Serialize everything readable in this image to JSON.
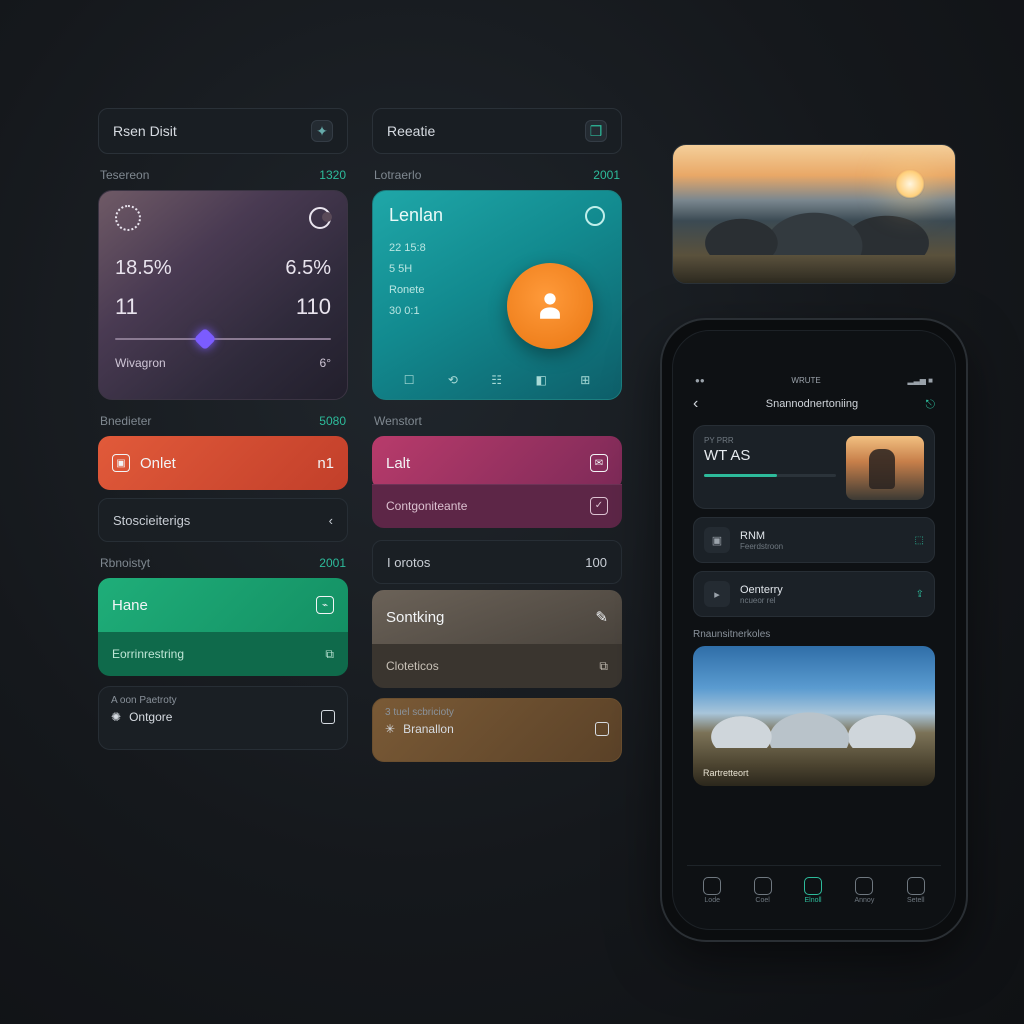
{
  "col1": {
    "header": "Rsen Disit",
    "section1": {
      "label": "Tesereon",
      "value": "1320"
    },
    "weather": {
      "val_left": "18.5%",
      "val_right": "6.5%",
      "num_left": "11",
      "num_right": "110",
      "footer_left": "Wivagron",
      "footer_right": "6°"
    },
    "section2": {
      "label": "Bnedieter",
      "value": "5080"
    },
    "card_red": "Onlet",
    "card_red_badge": "n1",
    "row1": "Stoscieiterigs",
    "section3": {
      "label": "Rbnoistyt",
      "value": "2001"
    },
    "card_green": "Hane",
    "card_green_sub": "Eorrinrestring",
    "mini_label": "A oon Paetroty",
    "mini_item": "Ontgore"
  },
  "col2": {
    "header": "Reeatie",
    "section1": {
      "label": "Lotraerlo",
      "value": "2001"
    },
    "teal": {
      "title": "Lenlan",
      "rows": [
        "22 15:8",
        "5 5H",
        "Ronete",
        "30 0:1"
      ],
      "icons": [
        "☐",
        "⟲",
        "☷",
        "◧",
        "⊞"
      ]
    },
    "section2": {
      "label": "Wenstort",
      "value": ""
    },
    "card_mag": "Lalt",
    "card_mag_sub": "Contgoniteante",
    "row1": "I orotos",
    "card_gry": "Sontking",
    "card_gry_sub": "Cloteticos",
    "mini_label": "3 tuel scbricioty",
    "mini_item": "Branallon"
  },
  "phone": {
    "status_left": "●●",
    "status_mid": "WRUTE",
    "status_right": "▂▃▅ ■",
    "nav_title": "Snannodnertoniing",
    "nav_acc": "⎋",
    "play": {
      "tag": "PY PRR",
      "title": "WT AS"
    },
    "list": [
      {
        "icon": "▣",
        "title": "RNM",
        "sub": "Feerdstroon",
        "badge": "⬚"
      },
      {
        "icon": "▸",
        "title": "Oenterry",
        "sub": "ncueor rel",
        "badge": "⇪"
      }
    ],
    "section": "Rnaunsitnerkoles",
    "caption": "Rartretteort",
    "tabs": [
      "Lode",
      "Coel",
      "Elnoll",
      "Annoy",
      "Setell"
    ]
  }
}
